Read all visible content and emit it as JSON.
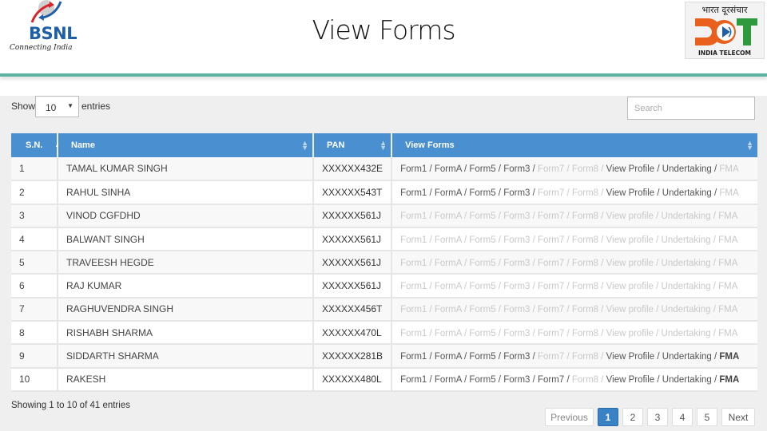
{
  "header": {
    "title": "View Forms",
    "left_logo": {
      "name": "BSNL",
      "tagline": "Connecting India"
    },
    "right_logo": {
      "hindi": "भारत दूरसंचार",
      "mark": "DOT",
      "subtitle": "INDIA TELECOM"
    }
  },
  "controls": {
    "show_label": "Show",
    "entries_label": "entries",
    "page_length": "10",
    "search_placeholder": "Search"
  },
  "table": {
    "columns": [
      "S.N.",
      "Name",
      "PAN",
      "View Forms"
    ],
    "rows": [
      {
        "sn": "1",
        "name": "TAMAL KUMAR SINGH",
        "pan": "XXXXXX432E",
        "forms": [
          {
            "label": "Form1",
            "state": "on"
          },
          {
            "label": "FormA",
            "state": "on"
          },
          {
            "label": "Form5",
            "state": "on"
          },
          {
            "label": "Form3",
            "state": "on"
          },
          {
            "label": "Form7",
            "state": "off"
          },
          {
            "label": "Form8",
            "state": "off"
          },
          {
            "label": "View Profile",
            "state": "on"
          },
          {
            "label": "Undertaking",
            "state": "on"
          },
          {
            "label": "FMA",
            "state": "off"
          }
        ]
      },
      {
        "sn": "2",
        "name": "RAHUL SINHA",
        "pan": "XXXXXX543T",
        "forms": [
          {
            "label": "Form1",
            "state": "on"
          },
          {
            "label": "FormA",
            "state": "on"
          },
          {
            "label": "Form5",
            "state": "on"
          },
          {
            "label": "Form3",
            "state": "on"
          },
          {
            "label": "Form7",
            "state": "off"
          },
          {
            "label": "Form8",
            "state": "off"
          },
          {
            "label": "View Profile",
            "state": "on"
          },
          {
            "label": "Undertaking",
            "state": "on"
          },
          {
            "label": "FMA",
            "state": "off"
          }
        ]
      },
      {
        "sn": "3",
        "name": "VINOD CGFDHD",
        "pan": "XXXXXX561J",
        "forms": [
          {
            "label": "Form1",
            "state": "off"
          },
          {
            "label": "FormA",
            "state": "off"
          },
          {
            "label": "Form5",
            "state": "off"
          },
          {
            "label": "Form3",
            "state": "off"
          },
          {
            "label": "Form7",
            "state": "off"
          },
          {
            "label": "Form8",
            "state": "off"
          },
          {
            "label": "View profile",
            "state": "off"
          },
          {
            "label": "Undertaking",
            "state": "off"
          },
          {
            "label": "FMA",
            "state": "off"
          }
        ]
      },
      {
        "sn": "4",
        "name": "BALWANT SINGH",
        "pan": "XXXXXX561J",
        "forms": [
          {
            "label": "Form1",
            "state": "off"
          },
          {
            "label": "FormA",
            "state": "off"
          },
          {
            "label": "Form5",
            "state": "off"
          },
          {
            "label": "Form3",
            "state": "off"
          },
          {
            "label": "Form7",
            "state": "off"
          },
          {
            "label": "Form8",
            "state": "off"
          },
          {
            "label": "View profile",
            "state": "off"
          },
          {
            "label": "Undertaking",
            "state": "off"
          },
          {
            "label": "FMA",
            "state": "off"
          }
        ]
      },
      {
        "sn": "5",
        "name": "TRAVEESH HEGDE",
        "pan": "XXXXXX561J",
        "forms": [
          {
            "label": "Form1",
            "state": "off"
          },
          {
            "label": "FormA",
            "state": "off"
          },
          {
            "label": "Form5",
            "state": "off"
          },
          {
            "label": "Form3",
            "state": "off"
          },
          {
            "label": "Form7",
            "state": "off"
          },
          {
            "label": "Form8",
            "state": "off"
          },
          {
            "label": "View profile",
            "state": "off"
          },
          {
            "label": "Undertaking",
            "state": "off"
          },
          {
            "label": "FMA",
            "state": "off"
          }
        ]
      },
      {
        "sn": "6",
        "name": "RAJ KUMAR",
        "pan": "XXXXXX561J",
        "forms": [
          {
            "label": "Form1",
            "state": "off"
          },
          {
            "label": "FormA",
            "state": "off"
          },
          {
            "label": "Form5",
            "state": "off"
          },
          {
            "label": "Form3",
            "state": "off"
          },
          {
            "label": "Form7",
            "state": "off"
          },
          {
            "label": "Form8",
            "state": "off"
          },
          {
            "label": "View profile",
            "state": "off"
          },
          {
            "label": "Undertaking",
            "state": "off"
          },
          {
            "label": "FMA",
            "state": "off"
          }
        ]
      },
      {
        "sn": "7",
        "name": "RAGHUVENDRA SINGH",
        "pan": "XXXXXX456T",
        "forms": [
          {
            "label": "Form1",
            "state": "off"
          },
          {
            "label": "FormA",
            "state": "off"
          },
          {
            "label": "Form5",
            "state": "off"
          },
          {
            "label": "Form3",
            "state": "off"
          },
          {
            "label": "Form7",
            "state": "off"
          },
          {
            "label": "Form8",
            "state": "off"
          },
          {
            "label": "View profile",
            "state": "off"
          },
          {
            "label": "Undertaking",
            "state": "off"
          },
          {
            "label": "FMA",
            "state": "off"
          }
        ]
      },
      {
        "sn": "8",
        "name": "RISHABH SHARMA",
        "pan": "XXXXXX470L",
        "forms": [
          {
            "label": "Form1",
            "state": "off"
          },
          {
            "label": "FormA",
            "state": "off"
          },
          {
            "label": "Form5",
            "state": "off"
          },
          {
            "label": "Form3",
            "state": "off"
          },
          {
            "label": "Form7",
            "state": "off"
          },
          {
            "label": "Form8",
            "state": "off"
          },
          {
            "label": "View profile",
            "state": "off"
          },
          {
            "label": "Undertaking",
            "state": "off"
          },
          {
            "label": "FMA",
            "state": "off"
          }
        ]
      },
      {
        "sn": "9",
        "name": "SIDDARTH SHARMA",
        "pan": "XXXXXX281B",
        "forms": [
          {
            "label": "Form1",
            "state": "on"
          },
          {
            "label": "FormA",
            "state": "on"
          },
          {
            "label": "Form5",
            "state": "on"
          },
          {
            "label": "Form3",
            "state": "on"
          },
          {
            "label": "Form7",
            "state": "off"
          },
          {
            "label": "Form8",
            "state": "off"
          },
          {
            "label": "View Profile",
            "state": "on"
          },
          {
            "label": "Undertaking",
            "state": "on"
          },
          {
            "label": "FMA",
            "state": "bold"
          }
        ]
      },
      {
        "sn": "10",
        "name": "RAKESH",
        "pan": "XXXXXX480L",
        "forms": [
          {
            "label": "Form1",
            "state": "on"
          },
          {
            "label": "FormA",
            "state": "on"
          },
          {
            "label": "Form5",
            "state": "on"
          },
          {
            "label": "Form3",
            "state": "on"
          },
          {
            "label": "Form7",
            "state": "on"
          },
          {
            "label": "Form8",
            "state": "off"
          },
          {
            "label": "View Profile",
            "state": "on"
          },
          {
            "label": "Undertaking",
            "state": "on"
          },
          {
            "label": "FMA",
            "state": "bold"
          }
        ]
      }
    ]
  },
  "footer": {
    "info": "Showing 1 to 10 of 41 entries",
    "pagination": {
      "previous": "Previous",
      "pages": [
        "1",
        "2",
        "3",
        "4",
        "5"
      ],
      "current": "1",
      "next": "Next"
    }
  },
  "colors": {
    "header_bg": "#4a8fd0",
    "active_page": "#3a82c6",
    "divider": "#5fb3a3",
    "link_active": "#555555",
    "link_disabled": "#c8c8c8"
  }
}
